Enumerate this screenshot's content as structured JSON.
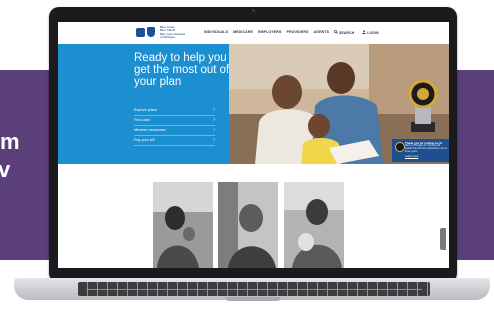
{
  "backdrop": {
    "text_line1": "m",
    "text_line2": "v",
    "band_color": "#5a3f7a"
  },
  "site": {
    "logo": {
      "name": "Blue Cross Blue Shield logo",
      "text_lines": [
        "Blue Cross",
        "Blue Shield",
        "Blue Care Network",
        "of Michigan"
      ]
    },
    "nav": [
      "INDIVIDUALS",
      "MEDICARE",
      "EMPLOYERS",
      "PROVIDERS",
      "AGENTS"
    ],
    "search_label": "SEARCH",
    "login_label": "LOGIN",
    "hero": {
      "headline": "Ready to help you get the most out of your plan",
      "menu": [
        {
          "label": "Explore plans",
          "icon": "chevron-right-icon"
        },
        {
          "label": "Find care",
          "icon": "chevron-right-icon"
        },
        {
          "label": "Member resources",
          "icon": "chevron-right-icon"
        },
        {
          "label": "Pay your bill",
          "icon": "chevron-right-icon"
        }
      ],
      "award": {
        "title": "Thank you for ranking us #1",
        "body": "Rank in Michigan for Commercial Health Plan Member Satisfaction two of three years",
        "link": "Learn more"
      }
    }
  },
  "colors": {
    "hero_blue": "#1b8fd0",
    "brand_navy": "#1f4e9a",
    "award_card": "#1e4f8f"
  }
}
